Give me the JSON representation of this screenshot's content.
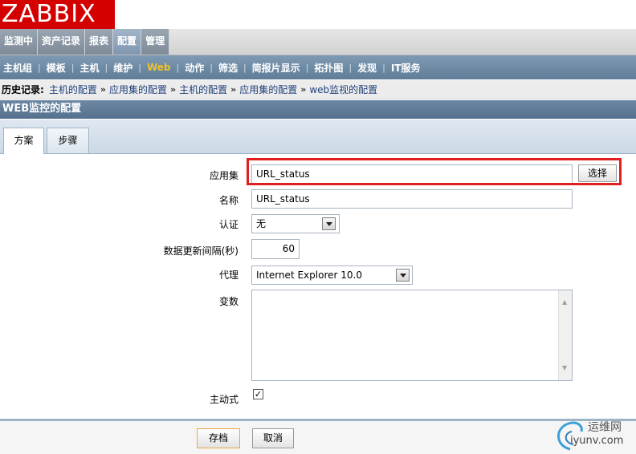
{
  "logo": "ZABBIX",
  "main_menu": [
    "监测中",
    "资产记录",
    "报表",
    "配置",
    "管理"
  ],
  "sub_menu": [
    "主机组",
    "模板",
    "主机",
    "维护",
    "Web",
    "动作",
    "筛选",
    "简报片显示",
    "拓扑图",
    "发现",
    "IT服务"
  ],
  "history": {
    "label": "历史记录:",
    "items": [
      "主机的配置",
      "应用集的配置",
      "主机的配置",
      "应用集的配置",
      "web监视的配置"
    ]
  },
  "page_title": "WEB监控的配置",
  "tabs": [
    "方案",
    "步骤"
  ],
  "form": {
    "application_label": "应用集",
    "application_value": "URL_status",
    "select_button": "选择",
    "name_label": "名称",
    "name_value": "URL_status",
    "auth_label": "认证",
    "auth_value": "无",
    "interval_label": "数据更新间隔(秒)",
    "interval_value": "60",
    "agent_label": "代理",
    "agent_value": "Internet Explorer 10.0",
    "variables_label": "变数",
    "variables_value": "",
    "active_label": "主动式",
    "active_checked": "✓"
  },
  "footer": {
    "save": "存档",
    "cancel": "取消"
  },
  "watermark": {
    "line1": "运维网",
    "line2": "iyunv.com"
  },
  "colors": {
    "logo_bg": "#d40000",
    "submenu_active": "#f6c223",
    "highlight_box": "#e02020",
    "title_bar": "#5f7d99"
  }
}
